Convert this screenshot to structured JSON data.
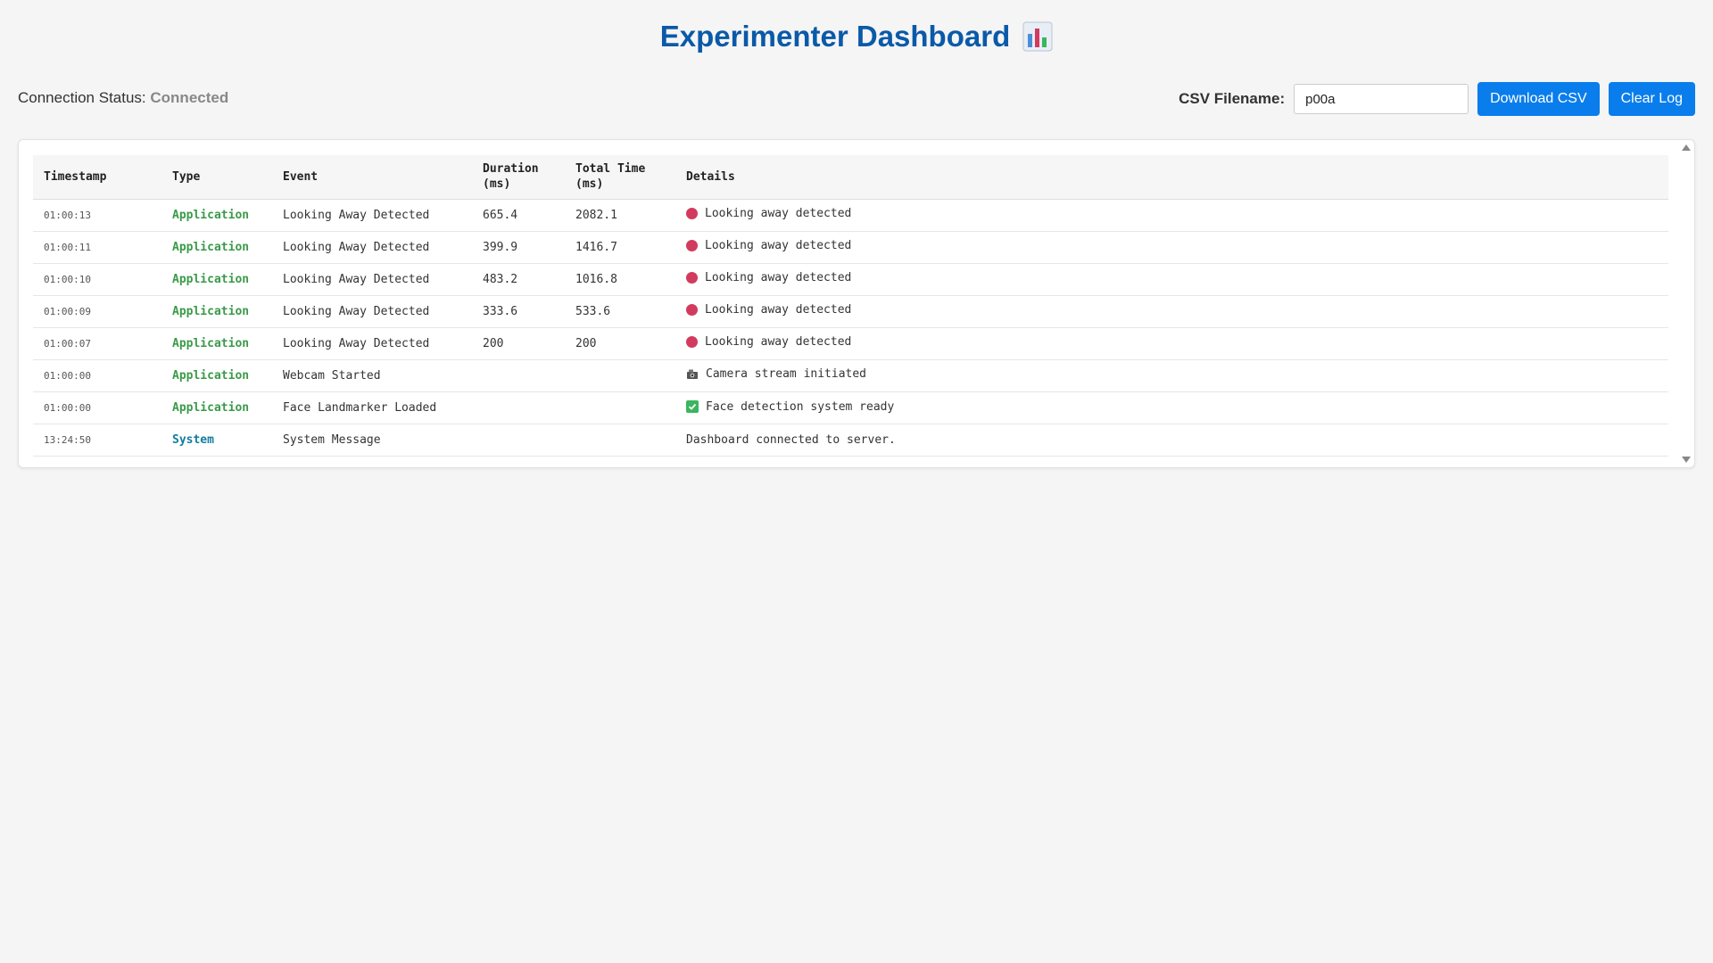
{
  "header": {
    "title": "Experimenter Dashboard",
    "title_icon": "bar-chart-icon"
  },
  "status": {
    "label": "Connection Status:",
    "value": "Connected"
  },
  "controls": {
    "csv_label": "CSV Filename:",
    "csv_value": "p00a",
    "download_label": "Download CSV",
    "clear_label": "Clear Log"
  },
  "table": {
    "columns": [
      "Timestamp",
      "Type",
      "Event",
      "Duration",
      "(ms)",
      "Total Time",
      "(ms)",
      "Details"
    ],
    "rows": [
      {
        "timestamp": "01:00:13",
        "type": "Application",
        "event": "Looking Away Detected",
        "duration": "665.4",
        "total": "2082.1",
        "icon": "red-dot-icon",
        "details": "Looking away detected"
      },
      {
        "timestamp": "01:00:11",
        "type": "Application",
        "event": "Looking Away Detected",
        "duration": "399.9",
        "total": "1416.7",
        "icon": "red-dot-icon",
        "details": "Looking away detected"
      },
      {
        "timestamp": "01:00:10",
        "type": "Application",
        "event": "Looking Away Detected",
        "duration": "483.2",
        "total": "1016.8",
        "icon": "red-dot-icon",
        "details": "Looking away detected"
      },
      {
        "timestamp": "01:00:09",
        "type": "Application",
        "event": "Looking Away Detected",
        "duration": "333.6",
        "total": "533.6",
        "icon": "red-dot-icon",
        "details": "Looking away detected"
      },
      {
        "timestamp": "01:00:07",
        "type": "Application",
        "event": "Looking Away Detected",
        "duration": "200",
        "total": "200",
        "icon": "red-dot-icon",
        "details": "Looking away detected"
      },
      {
        "timestamp": "01:00:00",
        "type": "Application",
        "event": "Webcam Started",
        "duration": "",
        "total": "",
        "icon": "camera-icon",
        "details": "Camera stream initiated"
      },
      {
        "timestamp": "01:00:00",
        "type": "Application",
        "event": "Face Landmarker Loaded",
        "duration": "",
        "total": "",
        "icon": "check-icon",
        "details": "Face detection system ready"
      },
      {
        "timestamp": "13:24:50",
        "type": "System",
        "event": "System Message",
        "duration": "",
        "total": "",
        "icon": "",
        "details": "Dashboard connected to server."
      }
    ]
  },
  "colors": {
    "title": "#0a5aa8",
    "button": "#0a7ded",
    "application": "#3a9a4a",
    "system": "#127da0",
    "alert_dot": "#d23a5e"
  }
}
